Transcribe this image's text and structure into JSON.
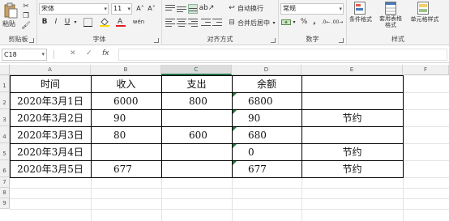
{
  "ribbon": {
    "clipboard": {
      "paste": "粘贴",
      "label": "剪贴板"
    },
    "font": {
      "name": "宋体",
      "size": "11",
      "bold": "B",
      "italic": "I",
      "underline": "U",
      "grow": "A˄",
      "shrink": "A˅",
      "wen": "wén",
      "label": "字体"
    },
    "alignment": {
      "wrap": "自动换行",
      "merge": "合并后居中",
      "label": "对齐方式"
    },
    "number": {
      "format": "常规",
      "percent": "%",
      "comma": ",",
      "label": "数字"
    },
    "styles": {
      "conditional": "条件格式",
      "table": "套用表格格式",
      "cell": "单元格样式",
      "label": "样式"
    }
  },
  "formula_bar": {
    "name_box": "C18",
    "cancel": "✕",
    "enter": "✓",
    "fx": "fx",
    "formula": ""
  },
  "columns": [
    "A",
    "B",
    "C",
    "D",
    "E",
    "F"
  ],
  "rows": [
    "1",
    "2",
    "3",
    "4",
    "5",
    "6",
    "7",
    "8",
    "9"
  ],
  "table": {
    "header": [
      "时间",
      "收入",
      "支出",
      "余额",
      ""
    ],
    "rows": [
      [
        "2020年3月1日",
        "6000",
        "800",
        "6800",
        ""
      ],
      [
        "2020年3月2日",
        "90",
        "",
        "90",
        "节约"
      ],
      [
        "2020年3月3日",
        "80",
        "600",
        "680",
        ""
      ],
      [
        "2020年3月4日",
        "",
        "",
        "0",
        "节约"
      ],
      [
        "2020年3月5日",
        "677",
        "",
        "677",
        "节约"
      ]
    ]
  },
  "colors": {
    "accent": "#217346",
    "triangle": "#1e7a3a"
  }
}
